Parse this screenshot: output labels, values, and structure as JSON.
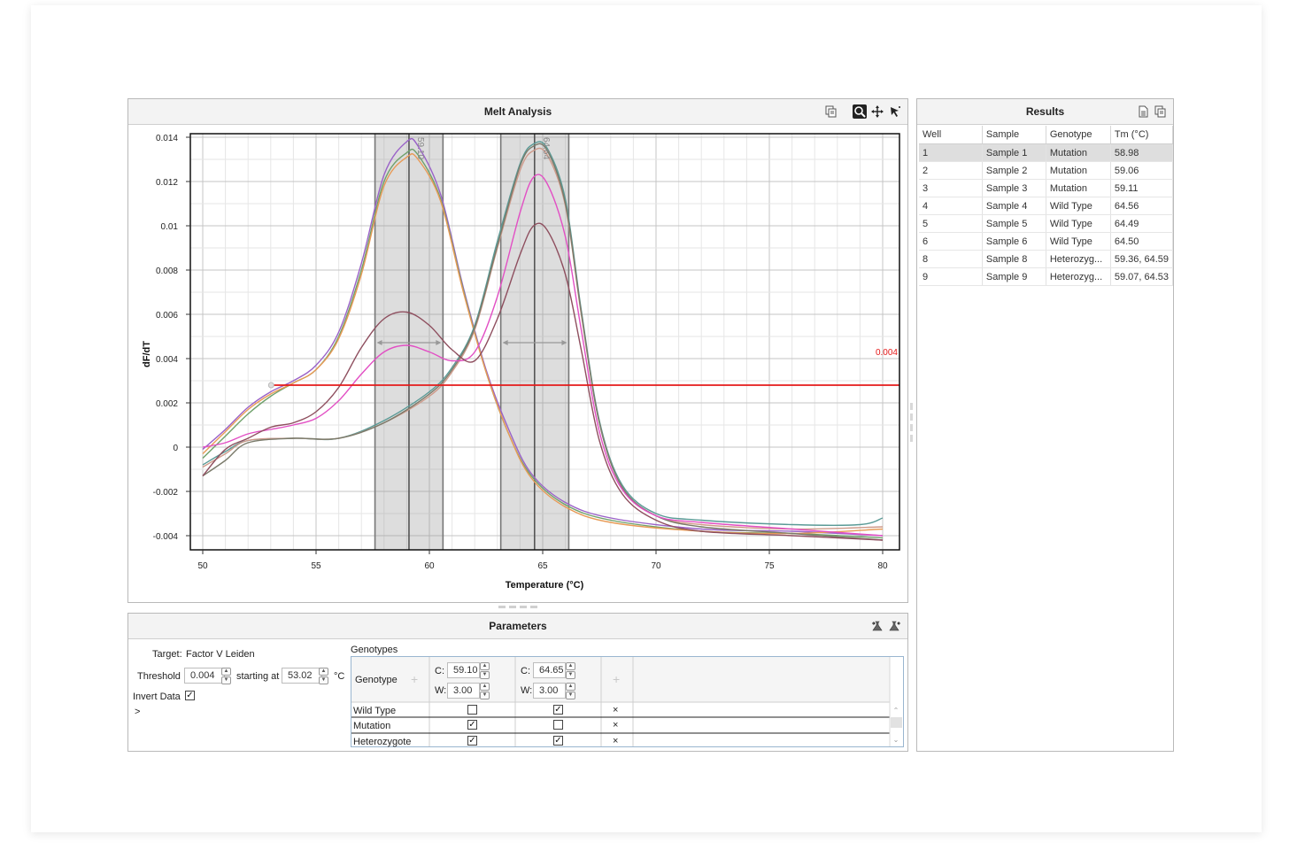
{
  "melt": {
    "title": "Melt Analysis",
    "icons": [
      "copy-icon",
      "zoom-icon",
      "pan-icon",
      "pointer-icon"
    ],
    "threshold_label": "0.004",
    "peak_labels": [
      "59.10",
      "64.64"
    ]
  },
  "chart_data": {
    "type": "line",
    "xlabel": "Temperature (°C)",
    "ylabel": "dF/dT",
    "xlim": [
      50,
      80.5
    ],
    "ylim": [
      -0.0046,
      0.0143
    ],
    "x_ticks": [
      "50",
      "55",
      "60",
      "65",
      "70",
      "75",
      "80"
    ],
    "y_ticks": [
      "0.014",
      "0.012",
      "0.01",
      "0.008",
      "0.006",
      "0.004",
      "0.002",
      "0",
      "-0.002",
      "-0.004"
    ],
    "threshold": {
      "value": 0.004,
      "from_x": 53.02,
      "color": "#e51a1a"
    },
    "regions": [
      {
        "center": 59.1,
        "width": 3.0,
        "from": 57.6,
        "to": 60.6
      },
      {
        "center": 64.64,
        "width": 3.0,
        "from": 63.15,
        "to": 66.15
      }
    ],
    "series": [
      {
        "color": "#9a62c8",
        "points": [
          [
            50,
            -0.0001
          ],
          [
            51,
            0.0008
          ],
          [
            52,
            0.0018
          ],
          [
            53,
            0.0025
          ],
          [
            54,
            0.003
          ],
          [
            55,
            0.0037
          ],
          [
            56,
            0.0052
          ],
          [
            57,
            0.0083
          ],
          [
            58,
            0.0123
          ],
          [
            59,
            0.0138
          ],
          [
            59.5,
            0.0136
          ],
          [
            60.5,
            0.0114
          ],
          [
            61.5,
            0.0072
          ],
          [
            62.5,
            0.0035
          ],
          [
            63.5,
            0.0008
          ],
          [
            64.5,
            -0.0012
          ],
          [
            66,
            -0.0025
          ],
          [
            68,
            -0.0032
          ],
          [
            72,
            -0.0037
          ],
          [
            76,
            -0.0038
          ],
          [
            80,
            -0.004
          ]
        ]
      },
      {
        "color": "#6ea06a",
        "points": [
          [
            50,
            -0.0005
          ],
          [
            51,
            0.0005
          ],
          [
            52,
            0.0015
          ],
          [
            53,
            0.0023
          ],
          [
            54,
            0.0029
          ],
          [
            55,
            0.0035
          ],
          [
            56,
            0.005
          ],
          [
            57,
            0.008
          ],
          [
            58,
            0.012
          ],
          [
            59,
            0.0133
          ],
          [
            59.5,
            0.0132
          ],
          [
            60.5,
            0.0112
          ],
          [
            61.5,
            0.0071
          ],
          [
            62.5,
            0.0034
          ],
          [
            63.5,
            0.0006
          ],
          [
            64.5,
            -0.0013
          ],
          [
            66,
            -0.0026
          ],
          [
            68,
            -0.0033
          ],
          [
            72,
            -0.0038
          ],
          [
            76,
            -0.0039
          ],
          [
            80,
            -0.0041
          ]
        ]
      },
      {
        "color": "#e89a56",
        "points": [
          [
            50,
            -0.0003
          ],
          [
            51,
            0.0007
          ],
          [
            52,
            0.0017
          ],
          [
            53,
            0.0024
          ],
          [
            54,
            0.0029
          ],
          [
            55,
            0.0035
          ],
          [
            56,
            0.0049
          ],
          [
            57,
            0.0078
          ],
          [
            58,
            0.0118
          ],
          [
            59,
            0.0131
          ],
          [
            59.5,
            0.013
          ],
          [
            60.5,
            0.0111
          ],
          [
            61.5,
            0.007
          ],
          [
            62.5,
            0.0034
          ],
          [
            63.5,
            0.0006
          ],
          [
            64.5,
            -0.0014
          ],
          [
            66,
            -0.0027
          ],
          [
            68,
            -0.0034
          ],
          [
            72,
            -0.0038
          ],
          [
            76,
            -0.0039
          ],
          [
            80,
            -0.0037
          ]
        ]
      },
      {
        "color": "#5a9a96",
        "points": [
          [
            50,
            -0.0008
          ],
          [
            51,
            -0.0002
          ],
          [
            52,
            0.0003
          ],
          [
            54,
            0.0004
          ],
          [
            56,
            0.0004
          ],
          [
            58,
            0.0012
          ],
          [
            60,
            0.0025
          ],
          [
            61,
            0.0036
          ],
          [
            62,
            0.0055
          ],
          [
            63,
            0.0093
          ],
          [
            64,
            0.0128
          ],
          [
            64.6,
            0.0137
          ],
          [
            65.2,
            0.0135
          ],
          [
            66,
            0.0112
          ],
          [
            66.7,
            0.0062
          ],
          [
            67.5,
            0.0012
          ],
          [
            68.5,
            -0.0017
          ],
          [
            70,
            -0.003
          ],
          [
            72,
            -0.0033
          ],
          [
            76,
            -0.0035
          ],
          [
            79,
            -0.0035
          ],
          [
            80,
            -0.0032
          ]
        ]
      },
      {
        "color": "#cf9a8a",
        "points": [
          [
            50,
            -0.0009
          ],
          [
            51,
            -0.0003
          ],
          [
            52,
            0.0003
          ],
          [
            54,
            0.0004
          ],
          [
            56,
            0.0004
          ],
          [
            58,
            0.0011
          ],
          [
            60,
            0.0023
          ],
          [
            61,
            0.0034
          ],
          [
            62,
            0.0053
          ],
          [
            63,
            0.009
          ],
          [
            64,
            0.0125
          ],
          [
            64.6,
            0.0134
          ],
          [
            65.2,
            0.0132
          ],
          [
            66,
            0.0109
          ],
          [
            66.7,
            0.006
          ],
          [
            67.5,
            0.0011
          ],
          [
            68.5,
            -0.0018
          ],
          [
            70,
            -0.0031
          ],
          [
            72,
            -0.0035
          ],
          [
            76,
            -0.0037
          ],
          [
            80,
            -0.0036
          ]
        ]
      },
      {
        "color": "#7a7a6a",
        "points": [
          [
            50,
            -0.0013
          ],
          [
            51,
            -0.0006
          ],
          [
            52,
            0.0002
          ],
          [
            54,
            0.0004
          ],
          [
            56,
            0.0004
          ],
          [
            58,
            0.0011
          ],
          [
            60,
            0.0024
          ],
          [
            61,
            0.0035
          ],
          [
            62,
            0.0054
          ],
          [
            63,
            0.0091
          ],
          [
            64,
            0.0127
          ],
          [
            64.6,
            0.0136
          ],
          [
            65.2,
            0.0134
          ],
          [
            66,
            0.011
          ],
          [
            66.7,
            0.0061
          ],
          [
            67.5,
            0.0011
          ],
          [
            68.5,
            -0.0018
          ],
          [
            70,
            -0.0031
          ],
          [
            72,
            -0.0036
          ],
          [
            76,
            -0.0039
          ],
          [
            80,
            -0.0042
          ]
        ]
      },
      {
        "color": "#e24fc4",
        "points": [
          [
            50,
            0
          ],
          [
            51,
            0.0002
          ],
          [
            52,
            0.0006
          ],
          [
            53,
            0.0008
          ],
          [
            54,
            0.001
          ],
          [
            55,
            0.0013
          ],
          [
            56,
            0.0021
          ],
          [
            57,
            0.0033
          ],
          [
            58,
            0.0043
          ],
          [
            59,
            0.0046
          ],
          [
            60,
            0.0043
          ],
          [
            61,
            0.0039
          ],
          [
            62,
            0.0043
          ],
          [
            63,
            0.0068
          ],
          [
            64,
            0.0106
          ],
          [
            64.6,
            0.0122
          ],
          [
            65.2,
            0.0119
          ],
          [
            66,
            0.0095
          ],
          [
            66.7,
            0.0053
          ],
          [
            67.5,
            0.0007
          ],
          [
            68.5,
            -0.0019
          ],
          [
            70,
            -0.0031
          ],
          [
            72,
            -0.0034
          ],
          [
            76,
            -0.0037
          ],
          [
            80,
            -0.004
          ]
        ]
      },
      {
        "color": "#8e4e5e",
        "points": [
          [
            50,
            -0.0013
          ],
          [
            51,
            -0.0001
          ],
          [
            52,
            0.0004
          ],
          [
            53,
            0.0009
          ],
          [
            54,
            0.0011
          ],
          [
            55,
            0.0016
          ],
          [
            56,
            0.0027
          ],
          [
            57,
            0.0045
          ],
          [
            58,
            0.0058
          ],
          [
            59,
            0.0061
          ],
          [
            60,
            0.0055
          ],
          [
            61,
            0.0044
          ],
          [
            62,
            0.0039
          ],
          [
            63,
            0.0058
          ],
          [
            64,
            0.0087
          ],
          [
            64.6,
            0.01
          ],
          [
            65.2,
            0.0098
          ],
          [
            66,
            0.0078
          ],
          [
            66.7,
            0.0044
          ],
          [
            67.5,
            0.0003
          ],
          [
            68.5,
            -0.0021
          ],
          [
            70,
            -0.0033
          ],
          [
            72,
            -0.0038
          ],
          [
            76,
            -0.004
          ],
          [
            80,
            -0.0042
          ]
        ]
      }
    ]
  },
  "results": {
    "title": "Results",
    "icons": [
      "export-icon",
      "copy-icon"
    ],
    "columns": [
      "Well",
      "Sample",
      "Genotype",
      "Tm (°C)"
    ],
    "rows": [
      {
        "well": "1",
        "sample": "Sample 1",
        "genotype": "Mutation",
        "tm": "58.98"
      },
      {
        "well": "2",
        "sample": "Sample 2",
        "genotype": "Mutation",
        "tm": "59.06"
      },
      {
        "well": "3",
        "sample": "Sample 3",
        "genotype": "Mutation",
        "tm": "59.11"
      },
      {
        "well": "4",
        "sample": "Sample 4",
        "genotype": "Wild Type",
        "tm": "64.56"
      },
      {
        "well": "5",
        "sample": "Sample 5",
        "genotype": "Wild Type",
        "tm": "64.49"
      },
      {
        "well": "6",
        "sample": "Sample 6",
        "genotype": "Wild Type",
        "tm": "64.50"
      },
      {
        "well": "8",
        "sample": "Sample 8",
        "genotype": "Heterozyg...",
        "tm": "59.36, 64.59"
      },
      {
        "well": "9",
        "sample": "Sample 9",
        "genotype": "Heterozyg...",
        "tm": "59.07, 64.53"
      }
    ]
  },
  "params": {
    "title": "Parameters",
    "icons": [
      "flask-export-icon",
      "flask-import-icon"
    ],
    "target_label": "Target:",
    "target_value": "Factor V Leiden",
    "threshold_label": "Threshold",
    "threshold_value": "0.004",
    "starting_at_label": "starting at",
    "starting_at_value": "53.02",
    "unit": "°C",
    "invert_label": "Invert Data",
    "invert_checked": true,
    "expand_glyph": ">",
    "genotypes_label": "Genotypes",
    "genotype_col_label": "Genotype",
    "c_label": "C:",
    "w_label": "W:",
    "peak1": {
      "c": "59.10",
      "w": "3.00"
    },
    "peak2": {
      "c": "64.65",
      "w": "3.00"
    },
    "rows": [
      {
        "name": "Wild Type",
        "p1": false,
        "p2": true
      },
      {
        "name": "Mutation",
        "p1": true,
        "p2": false
      },
      {
        "name": "Heterozygote",
        "p1": true,
        "p2": true
      }
    ]
  }
}
